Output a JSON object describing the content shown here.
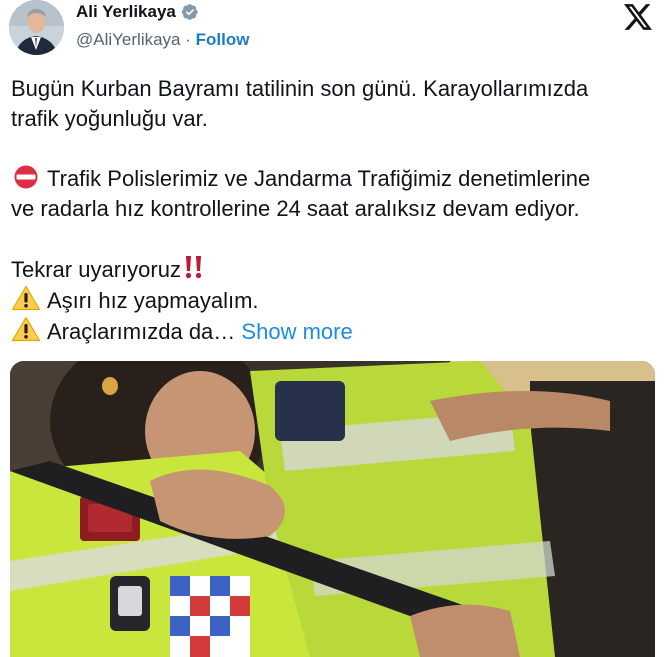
{
  "author": {
    "name": "Ali Yerlikaya",
    "handle": "@AliYerlikaya",
    "separator": "·",
    "follow_label": "Follow"
  },
  "icons": {
    "verified": "verified-badge-icon",
    "brand": "x-logo-icon",
    "no_entry": "no-entry-emoji",
    "warning": "warning-emoji",
    "alert": "double-exclamation-emoji"
  },
  "colors": {
    "follow": "#1d7bc7",
    "show_more": "#1d8be0",
    "verified": "#829aab"
  },
  "tweet": {
    "line1": "Bugün Kurban Bayramı tatilinin son günü. Karayollarımızda",
    "line2": "trafik yoğunluğu var.",
    "line3": "Trafik Polislerimiz ve Jandarma Trafiğimiz denetimlerine",
    "line4": "ve radarla hız kontrollerine 24 saat aralıksız devam ediyor.",
    "line5": "Tekrar uyarıyoruz",
    "line6": "Aşırı hız yapmayalım.",
    "line7": "Araçlarımızda da…",
    "show_more": "Show more"
  }
}
